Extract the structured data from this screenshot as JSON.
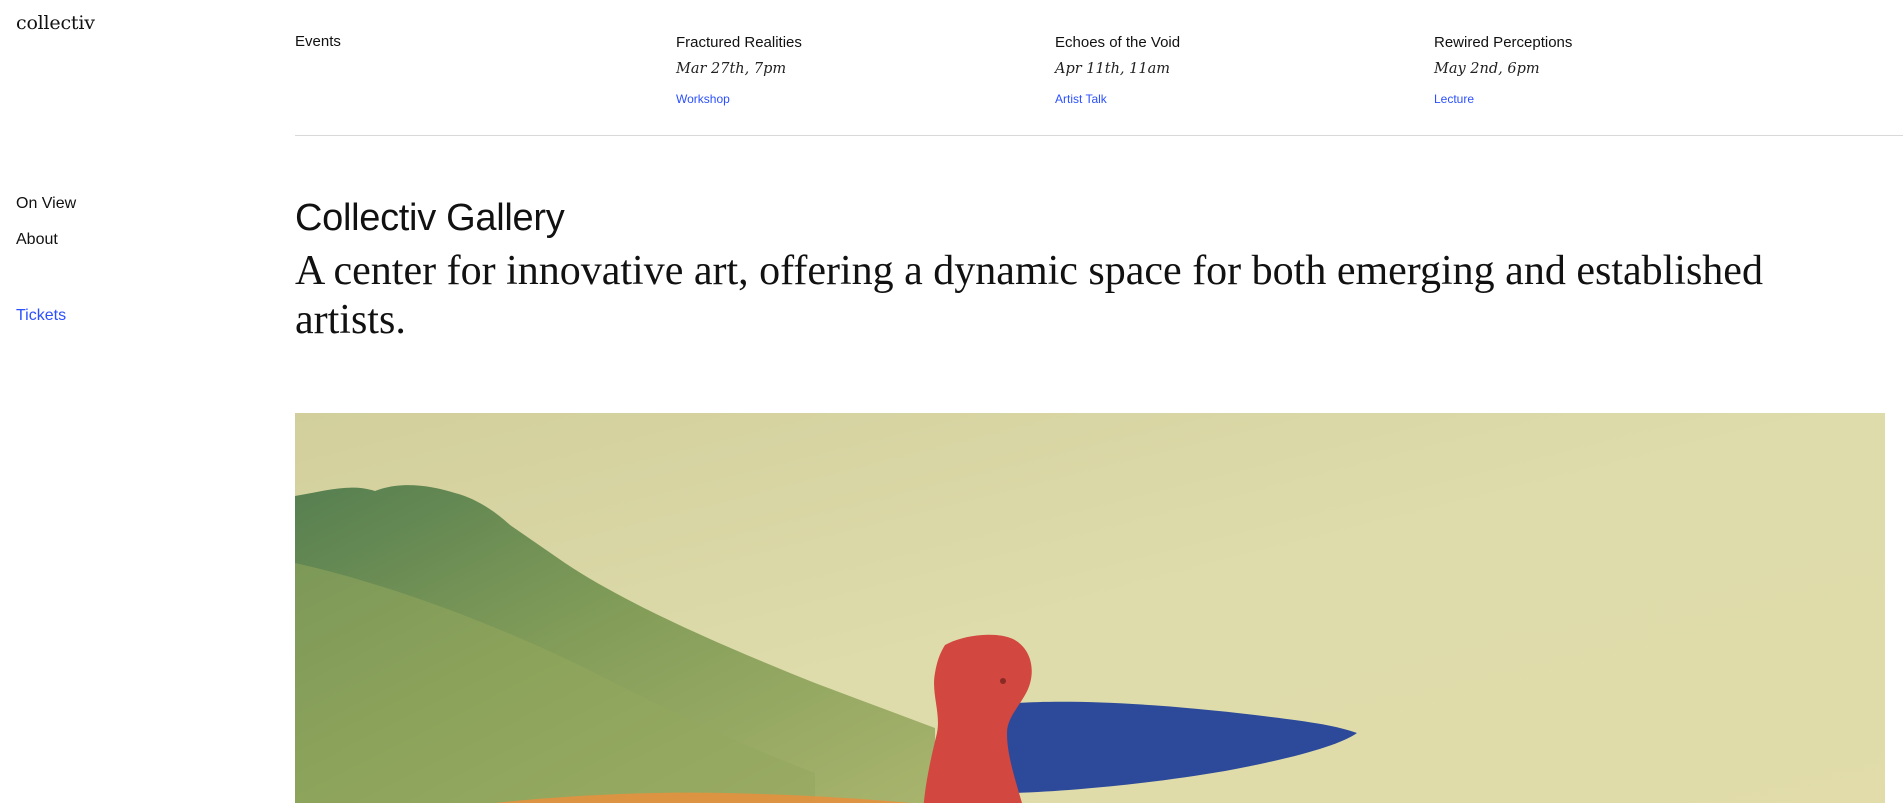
{
  "header": {
    "logo": "collectiv"
  },
  "sidebar": {
    "items": [
      {
        "label": "On View"
      },
      {
        "label": "About"
      }
    ],
    "tickets_label": "Tickets"
  },
  "events": {
    "label": "Events",
    "items": [
      {
        "title": "Fractured Realities",
        "date": "Mar 27th, 7pm",
        "tag": "Workshop"
      },
      {
        "title": "Echoes of the Void",
        "date": "Apr 11th, 11am",
        "tag": "Artist Talk"
      },
      {
        "title": "Rewired Perceptions",
        "date": "May 2nd, 6pm",
        "tag": "Lecture"
      }
    ]
  },
  "main": {
    "title": "Collectiv Gallery",
    "tagline": "A center for innovative art, offering a dynamic space for both emerging and established artists."
  },
  "colors": {
    "accent": "#2b50ff",
    "text": "#111111",
    "divider": "#d9d9d9",
    "artwork_background": "#dcd9a8",
    "artwork_red": "#d2473f",
    "artwork_blue": "#2d4a9a",
    "artwork_green": "#7e9a55"
  }
}
